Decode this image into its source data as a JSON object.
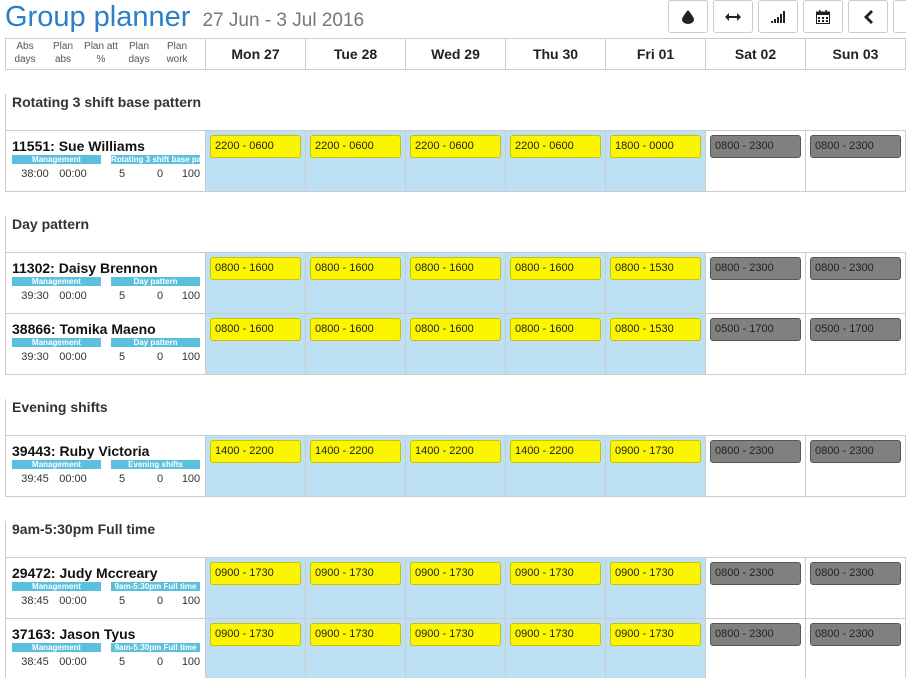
{
  "header": {
    "title": "Group planner",
    "date_range": "27 Jun - 3 Jul 2016"
  },
  "toolbar": {
    "buttons": [
      {
        "icon": "drop-icon"
      },
      {
        "icon": "expand-arrows-icon"
      },
      {
        "icon": "signal-bars-icon"
      },
      {
        "icon": "calendar-icon"
      },
      {
        "icon": "chevron-left-icon"
      },
      {
        "icon": "chevron-right-icon"
      }
    ]
  },
  "columns": {
    "stats": [
      "Abs days",
      "Plan abs",
      "Plan att %",
      "Plan days",
      "Plan work"
    ],
    "days": [
      "Mon 27",
      "Tue 28",
      "Wed 29",
      "Thu 30",
      "Fri 01",
      "Sat 02",
      "Sun 03"
    ]
  },
  "colors": {
    "accent": "#2a7fc8",
    "workday_bg": "#bde0f5",
    "shift_work": "#fbf500",
    "shift_off": "#808080",
    "tag": "#5bc0de"
  },
  "groups": [
    {
      "name": "Rotating 3 shift base pattern",
      "people": [
        {
          "name": "11551: Sue Williams",
          "tag1": "Management",
          "tag2": "Rotating 3 shift base pattern",
          "abs": "38:00",
          "plan_abs": "00:00",
          "plan_days": "5",
          "plan_work": "0",
          "att": "100",
          "shifts": [
            "2200 - 0600",
            "2200 - 0600",
            "2200 - 0600",
            "2200 - 0600",
            "1800 - 0000",
            "0800 - 2300",
            "0800 - 2300"
          ]
        }
      ]
    },
    {
      "name": "Day pattern",
      "people": [
        {
          "name": "11302: Daisy Brennon",
          "tag1": "Management",
          "tag2": "Day pattern",
          "abs": "39:30",
          "plan_abs": "00:00",
          "plan_days": "5",
          "plan_work": "0",
          "att": "100",
          "shifts": [
            "0800 - 1600",
            "0800 - 1600",
            "0800 - 1600",
            "0800 - 1600",
            "0800 - 1530",
            "0800 - 2300",
            "0800 - 2300"
          ]
        },
        {
          "name": "38866: Tomika Maeno",
          "tag1": "Management",
          "tag2": "Day pattern",
          "abs": "39:30",
          "plan_abs": "00:00",
          "plan_days": "5",
          "plan_work": "0",
          "att": "100",
          "shifts": [
            "0800 - 1600",
            "0800 - 1600",
            "0800 - 1600",
            "0800 - 1600",
            "0800 - 1530",
            "0500 - 1700",
            "0500 - 1700"
          ]
        }
      ]
    },
    {
      "name": "Evening shifts",
      "people": [
        {
          "name": "39443: Ruby Victoria",
          "tag1": "Management",
          "tag2": "Evening shifts",
          "abs": "39:45",
          "plan_abs": "00:00",
          "plan_days": "5",
          "plan_work": "0",
          "att": "100",
          "shifts": [
            "1400 - 2200",
            "1400 - 2200",
            "1400 - 2200",
            "1400 - 2200",
            "0900 - 1730",
            "0800 - 2300",
            "0800 - 2300"
          ]
        }
      ]
    },
    {
      "name": "9am-5:30pm Full time",
      "people": [
        {
          "name": "29472: Judy Mccreary",
          "tag1": "Management",
          "tag2": "9am-5:30pm Full time",
          "abs": "38:45",
          "plan_abs": "00:00",
          "plan_days": "5",
          "plan_work": "0",
          "att": "100",
          "shifts": [
            "0900 - 1730",
            "0900 - 1730",
            "0900 - 1730",
            "0900 - 1730",
            "0900 - 1730",
            "0800 - 2300",
            "0800 - 2300"
          ]
        },
        {
          "name": "37163: Jason Tyus",
          "tag1": "Management",
          "tag2": "9am-5:30pm Full time",
          "abs": "38:45",
          "plan_abs": "00:00",
          "plan_days": "5",
          "plan_work": "0",
          "att": "100",
          "shifts": [
            "0900 - 1730",
            "0900 - 1730",
            "0900 - 1730",
            "0900 - 1730",
            "0900 - 1730",
            "0800 - 2300",
            "0800 - 2300"
          ]
        }
      ]
    }
  ]
}
